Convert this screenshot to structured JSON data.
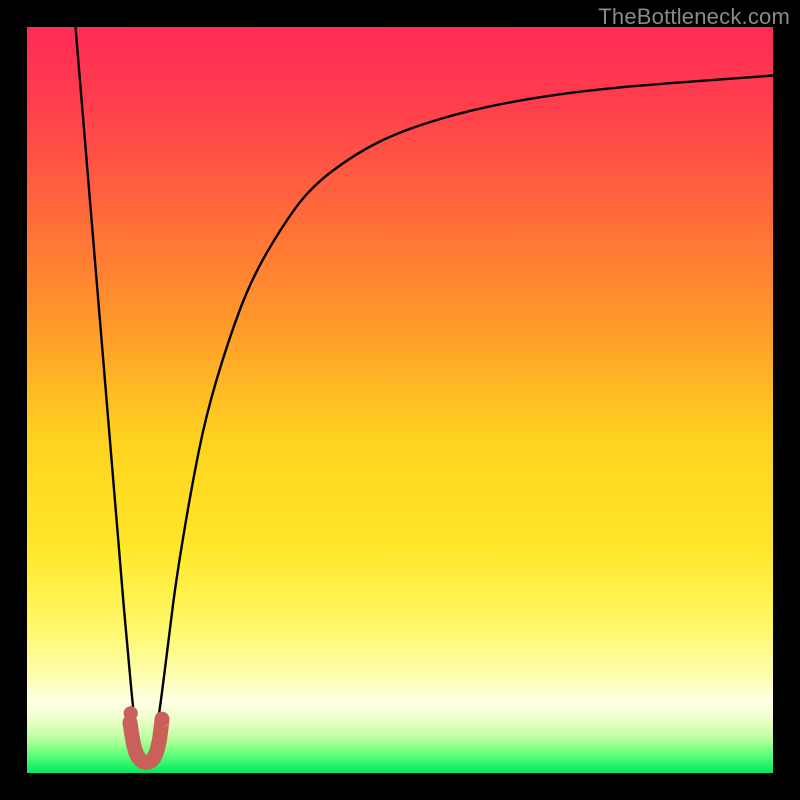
{
  "watermark": {
    "text": "TheBottleneck.com"
  },
  "colors": {
    "black": "#000000",
    "curve": "#000000",
    "marker_fill": "#c9605a",
    "marker_stroke": "#c9605a",
    "gradient_stops": [
      {
        "offset": 0.0,
        "color": "#ff2b55"
      },
      {
        "offset": 0.1,
        "color": "#ff3d4e"
      },
      {
        "offset": 0.25,
        "color": "#ff6a3a"
      },
      {
        "offset": 0.4,
        "color": "#ff9a2a"
      },
      {
        "offset": 0.55,
        "color": "#ffd21f"
      },
      {
        "offset": 0.7,
        "color": "#ffe72a"
      },
      {
        "offset": 0.8,
        "color": "#fff765"
      },
      {
        "offset": 0.87,
        "color": "#fdffb0"
      },
      {
        "offset": 0.905,
        "color": "#ffffe6"
      },
      {
        "offset": 0.93,
        "color": "#eaffc6"
      },
      {
        "offset": 0.955,
        "color": "#b7ff9e"
      },
      {
        "offset": 0.975,
        "color": "#63ff79"
      },
      {
        "offset": 1.0,
        "color": "#00e763"
      }
    ]
  },
  "chart_data": {
    "type": "line",
    "title": "",
    "xlabel": "",
    "ylabel": "",
    "xlim": [
      0,
      100
    ],
    "ylim": [
      0,
      100
    ],
    "grid": false,
    "legend": false,
    "annotations": [
      "TheBottleneck.com"
    ],
    "series": [
      {
        "name": "left-branch",
        "x": [
          6.5,
          7.0,
          8.0,
          9.0,
          10.0,
          11.0,
          12.0,
          13.0,
          14.0,
          14.8
        ],
        "y": [
          100,
          94,
          82,
          70,
          58,
          46,
          34,
          22,
          11,
          3
        ]
      },
      {
        "name": "right-branch",
        "x": [
          17.0,
          18.0,
          19.0,
          20.0,
          22.0,
          24.0,
          27.0,
          30.0,
          34.0,
          38.0,
          44.0,
          50.0,
          58.0,
          66.0,
          75.0,
          85.0,
          95.0,
          100.0
        ],
        "y": [
          3,
          10,
          18,
          26,
          38,
          48,
          58,
          66,
          73,
          78.5,
          83,
          86,
          88.5,
          90.2,
          91.5,
          92.4,
          93.1,
          93.5
        ]
      },
      {
        "name": "valley-marker",
        "x": [
          13.8,
          14.3,
          15.0,
          16.0,
          17.0,
          17.7,
          18.1
        ],
        "y": [
          6.8,
          3.5,
          1.8,
          1.3,
          1.8,
          3.8,
          7.2
        ]
      }
    ],
    "marker": {
      "x": 13.9,
      "y": 8.0,
      "r_percent": 0.95
    }
  }
}
